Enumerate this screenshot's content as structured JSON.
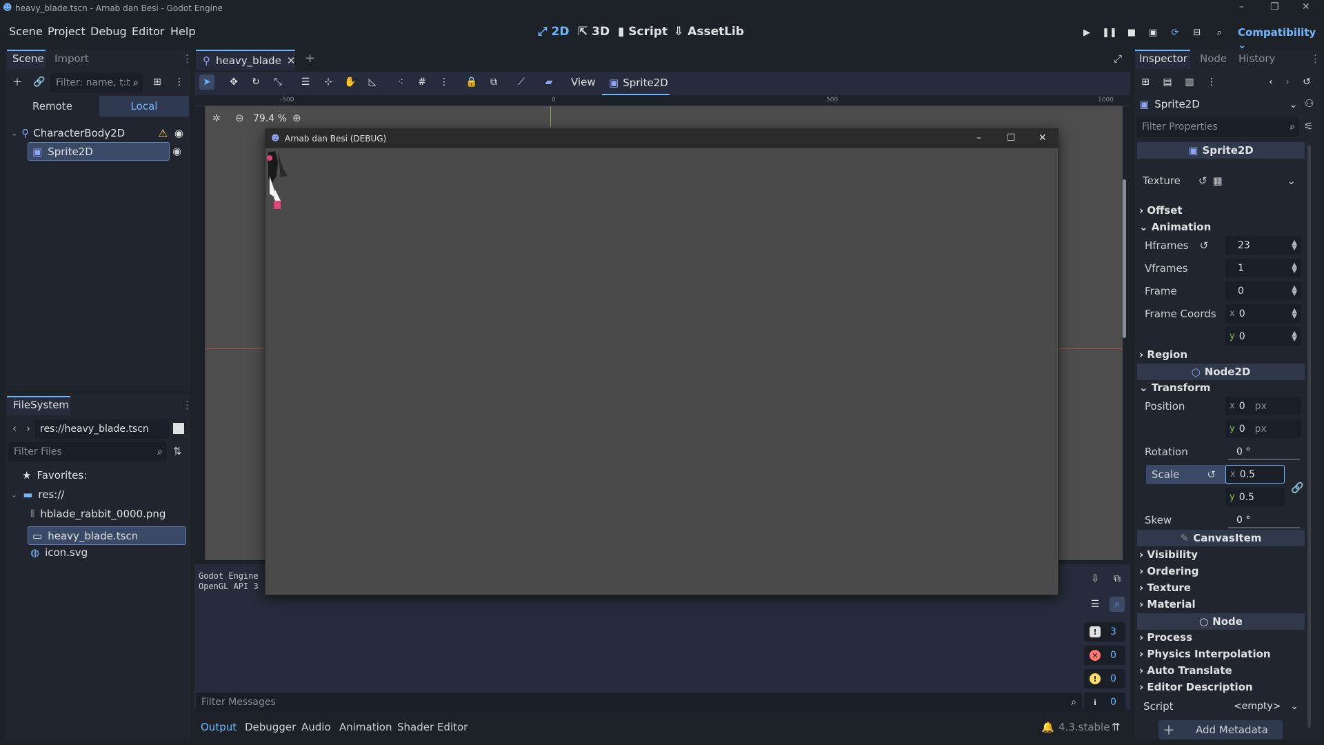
{
  "window": {
    "title": "heavy_blade.tscn - Arnab dan Besi - Godot Engine"
  },
  "menu": [
    "Scene",
    "Project",
    "Debug",
    "Editor",
    "Help"
  ],
  "modes": {
    "m2d": "2D",
    "m3d": "3D",
    "script": "Script",
    "assetlib": "AssetLib"
  },
  "renderer": "Compatibility",
  "scene_dock": {
    "tabs": [
      "Scene",
      "Import"
    ],
    "filter_placeholder": "Filter: name, t:t",
    "remote": "Remote",
    "local": "Local",
    "nodes": [
      "CharacterBody2D",
      "Sprite2D"
    ]
  },
  "filesystem": {
    "tab": "FileSystem",
    "path": "res://heavy_blade.tscn",
    "filter_placeholder": "Filter Files",
    "favorites": "Favorites:",
    "root": "res://",
    "files": [
      "hblade_rabbit_0000.png",
      "heavy_blade.tscn",
      "icon.svg"
    ]
  },
  "editor": {
    "tab": "heavy_blade",
    "view": "View",
    "node": "Sprite2D",
    "zoom": "79.4 %",
    "ruler": [
      "-500",
      "0",
      "500",
      "1000"
    ]
  },
  "debug_window": {
    "title": "Arnab dan Besi (DEBUG)"
  },
  "output": {
    "lines": [
      "Godot Engine",
      "OpenGL API 3"
    ],
    "filter_placeholder": "Filter Messages",
    "counts": {
      "msg": "3",
      "err": "0",
      "warn": "0",
      "info": "0"
    },
    "tabs": [
      "Output",
      "Debugger",
      "Audio",
      "Animation",
      "Shader Editor"
    ],
    "version": "4.3.stable"
  },
  "inspector": {
    "tabs": [
      "Inspector",
      "Node",
      "History"
    ],
    "object": "Sprite2D",
    "filter_placeholder": "Filter Properties",
    "class_sprite": "Sprite2D",
    "texture": "Texture",
    "offset": "Offset",
    "animation": "Animation",
    "hframes_label": "Hframes",
    "hframes": "23",
    "vframes_label": "Vframes",
    "vframes": "1",
    "frame_label": "Frame",
    "frame": "0",
    "frame_coords_label": "Frame Coords",
    "fc_x": "0",
    "fc_y": "0",
    "region": "Region",
    "class_node2d": "Node2D",
    "transform": "Transform",
    "position_label": "Position",
    "pos_x": "0",
    "pos_y": "0",
    "px": "px",
    "rotation_label": "Rotation",
    "rotation": "0 °",
    "scale_label": "Scale",
    "scale_x": "0.5",
    "scale_y": "0.5",
    "skew_label": "Skew",
    "skew": "0 °",
    "class_canvas": "CanvasItem",
    "canvas_sections": [
      "Visibility",
      "Ordering",
      "Texture",
      "Material"
    ],
    "class_node": "Node",
    "node_sections": [
      "Process",
      "Physics Interpolation",
      "Auto Translate",
      "Editor Description"
    ],
    "script_label": "Script",
    "script_value": "<empty>",
    "add_metadata": "Add Metadata"
  }
}
